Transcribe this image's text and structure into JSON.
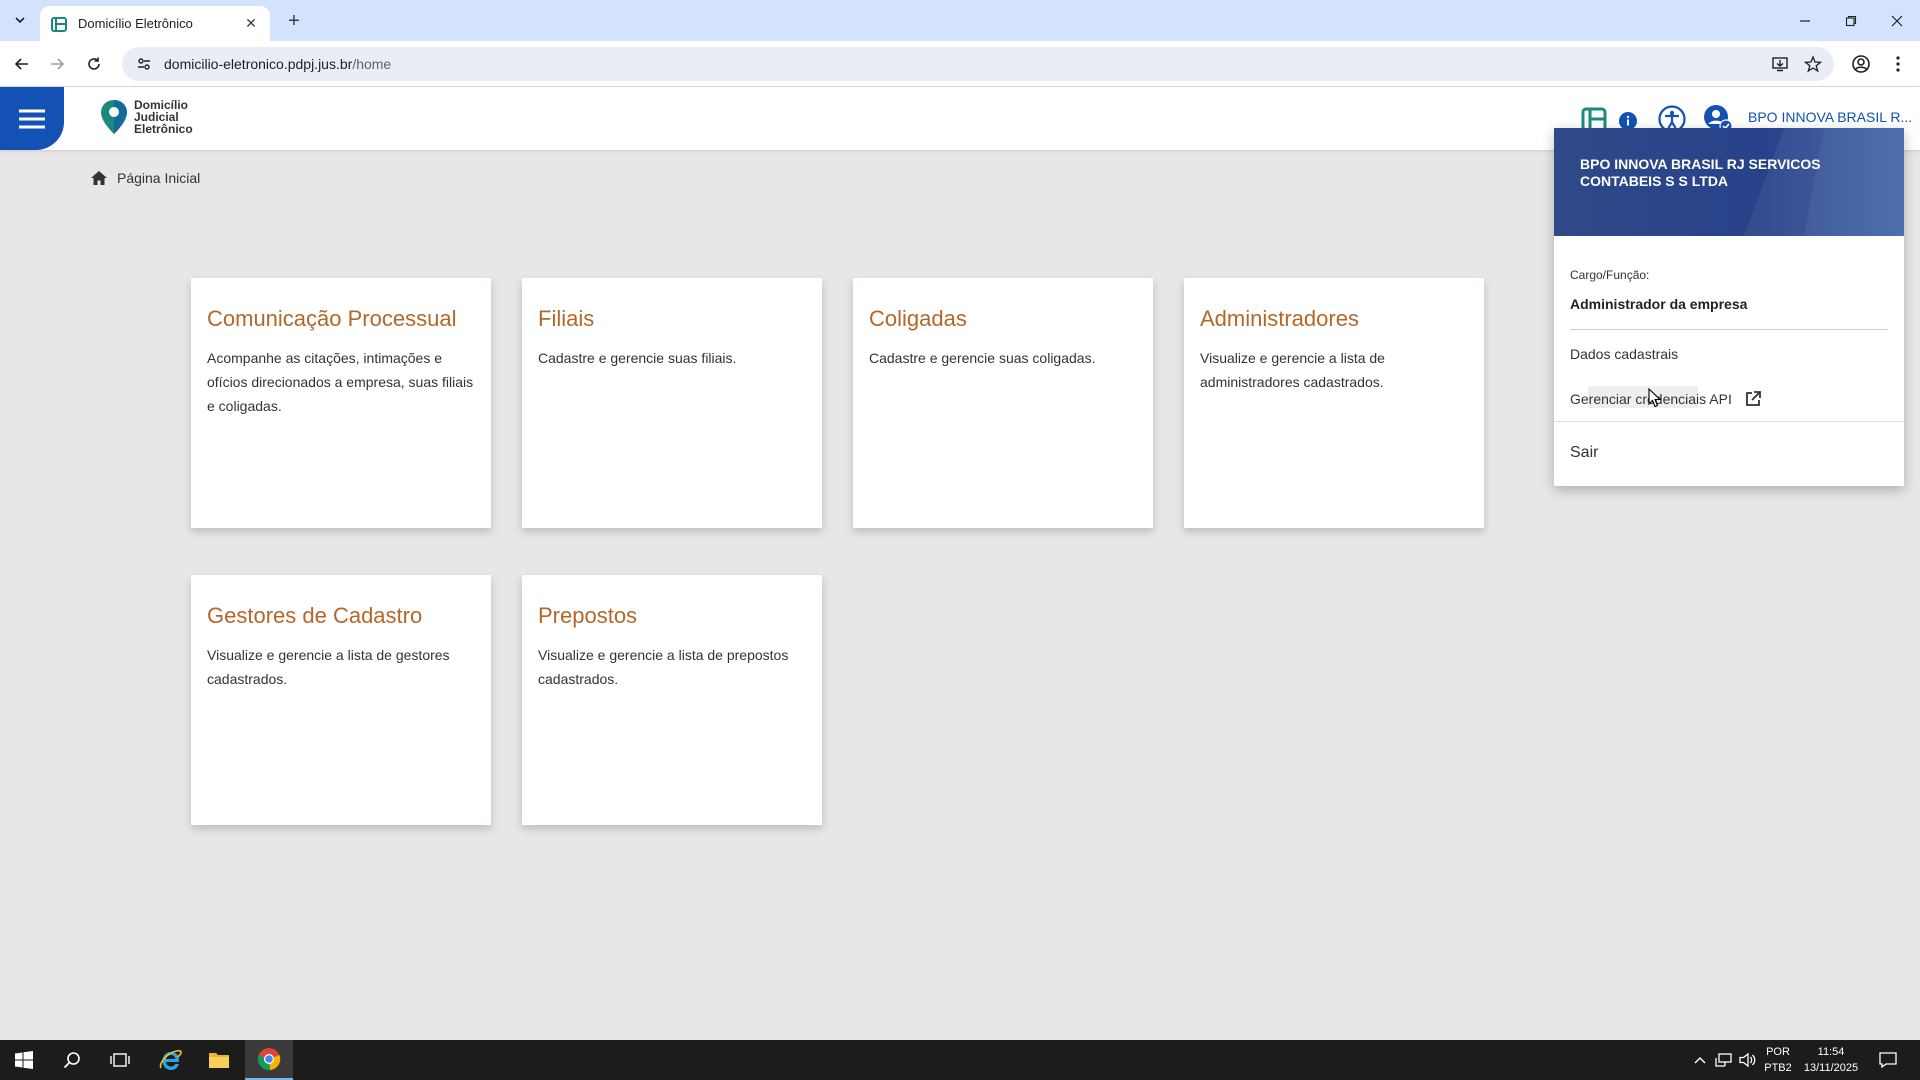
{
  "browser": {
    "tab_title": "Domicílio Eletrônico",
    "url_host": "domicilio-eletronico.pdpj.jus.br",
    "url_path": "/home"
  },
  "header": {
    "logo_lines": [
      "Domicílio",
      "Judicial",
      "Eletrônico"
    ],
    "user_name": "BPO INNOVA BRASIL R..."
  },
  "breadcrumb": {
    "label": "Página Inicial"
  },
  "cards": [
    {
      "title": "Comunicação Processual",
      "description": "Acompanhe as citações, intimações e ofícios direcionados a empresa, suas filiais e coligadas."
    },
    {
      "title": "Filiais",
      "description": "Cadastre e gerencie suas filiais."
    },
    {
      "title": "Coligadas",
      "description": "Cadastre e gerencie suas coligadas."
    },
    {
      "title": "Administradores",
      "description": "Visualize e gerencie a lista de administradores cadastrados."
    },
    {
      "title": "Gestores de Cadastro",
      "description": "Visualize e gerencie a lista de gestores cadastrados."
    },
    {
      "title": "Prepostos",
      "description": "Visualize e gerencie a lista de prepostos cadastrados."
    }
  ],
  "dropdown": {
    "company_name": "BPO INNOVA BRASIL RJ SERVICOS CONTABEIS S S LTDA",
    "role_label": "Cargo/Função:",
    "role_value": "Administrador da empresa",
    "items": [
      "Dados cadastrais",
      "Gerenciar credenciais API"
    ],
    "logout": "Sair"
  },
  "taskbar": {
    "language": "POR",
    "keyboard": "PTB2",
    "time": "11:54",
    "date": "13/11/2025"
  },
  "colors": {
    "primary_blue": "#1351b4",
    "card_title": "#b5672a",
    "page_background": "#e8e6e6",
    "logo_teal": "#1b8a7d"
  }
}
